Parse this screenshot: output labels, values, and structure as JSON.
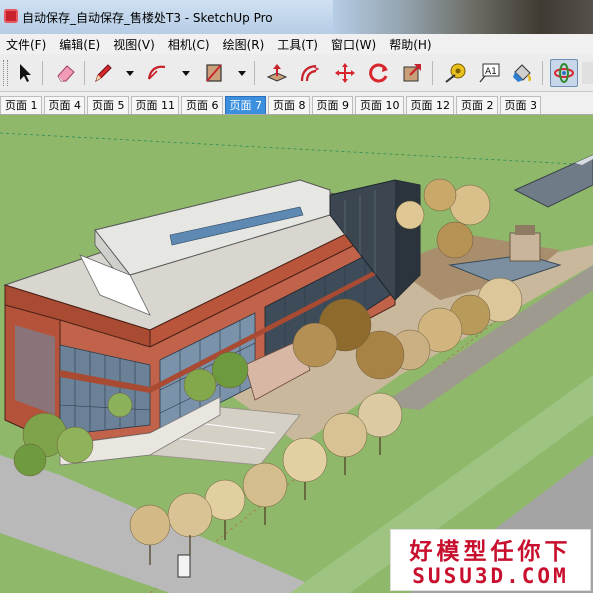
{
  "window": {
    "title": "自动保存_自动保存_售楼处T3 - SketchUp Pro",
    "app_icon": "sketchup-icon",
    "accent_color": "#c8232c"
  },
  "menu": {
    "items": [
      {
        "label": "文件(F)"
      },
      {
        "label": "编辑(E)"
      },
      {
        "label": "视图(V)"
      },
      {
        "label": "相机(C)"
      },
      {
        "label": "绘图(R)"
      },
      {
        "label": "工具(T)"
      },
      {
        "label": "窗口(W)"
      },
      {
        "label": "帮助(H)"
      }
    ]
  },
  "toolbar": {
    "tools": [
      {
        "name": "select-tool",
        "icon": "arrow-cursor-icon"
      },
      {
        "name": "eraser-tool",
        "icon": "eraser-icon"
      },
      {
        "name": "line-tool",
        "icon": "pencil-icon"
      },
      {
        "name": "arc-tool",
        "icon": "arc-icon"
      },
      {
        "name": "rectangle-tool",
        "icon": "rectangle-icon"
      },
      {
        "name": "push-pull-tool",
        "icon": "push-pull-icon"
      },
      {
        "name": "offset-tool",
        "icon": "offset-icon"
      },
      {
        "name": "move-tool",
        "icon": "move-arrows-icon"
      },
      {
        "name": "rotate-tool",
        "icon": "rotate-icon"
      },
      {
        "name": "scale-tool",
        "icon": "scale-icon"
      },
      {
        "name": "tape-measure-tool",
        "icon": "tape-measure-icon"
      },
      {
        "name": "text-tool",
        "icon": "text-label-icon",
        "label": "A1"
      },
      {
        "name": "paint-bucket-tool",
        "icon": "paint-bucket-icon"
      },
      {
        "name": "orbit-tool",
        "icon": "orbit-icon",
        "active": true
      }
    ]
  },
  "scenes": {
    "tabs": [
      {
        "label": "页面 1"
      },
      {
        "label": "页面 4"
      },
      {
        "label": "页面 5"
      },
      {
        "label": "页面 11"
      },
      {
        "label": "页面 6"
      },
      {
        "label": "页面 7",
        "active": true
      },
      {
        "label": "页面 8"
      },
      {
        "label": "页面 9"
      },
      {
        "label": "页面 10"
      },
      {
        "label": "页面 12"
      },
      {
        "label": "页面 2"
      },
      {
        "label": "页面 3"
      }
    ],
    "active_color": "#3c8fde"
  },
  "viewport": {
    "description_colors": {
      "grass": "#8fb86b",
      "facade": "#b8553a",
      "glass": "#6f8aa3",
      "road": "#a9a9a9"
    }
  },
  "watermark": {
    "line1": "好模型任你下",
    "line2": "SUSU3D.COM",
    "color": "#c8102e"
  }
}
